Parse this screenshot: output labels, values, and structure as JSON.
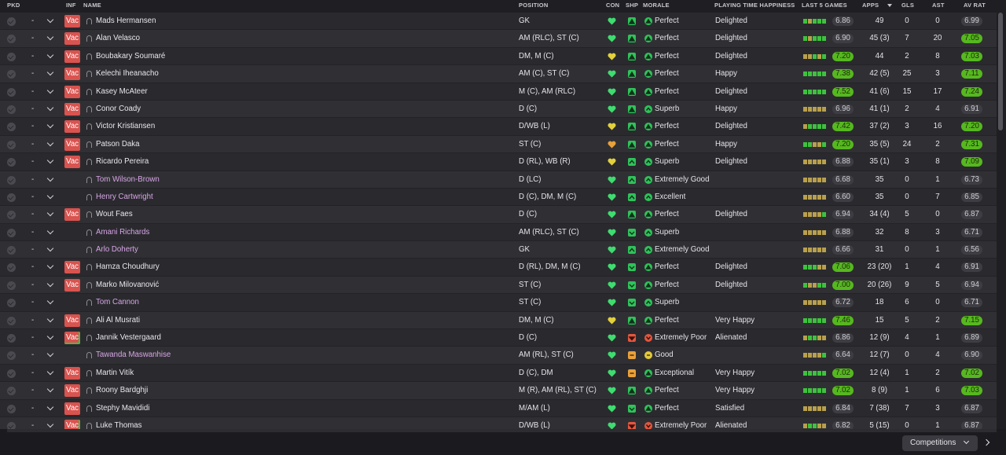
{
  "headers": {
    "pkd": "PKD",
    "inf": "INF",
    "name": "NAME",
    "position": "POSITION",
    "con": "CON",
    "shp": "SHP",
    "morale": "MORALE",
    "playing_time": "PLAYING TIME HAPPINESS",
    "last5": "LAST 5 GAMES",
    "apps": "APPS",
    "gls": "GLS",
    "ast": "AST",
    "avrat": "AV RAT"
  },
  "sorted_column": "apps",
  "sort_direction": "descending",
  "row_dash": "-",
  "inf_badge_label": "Vac",
  "colors": {
    "form_green": "#3ec23e",
    "form_amber": "#b9a04d",
    "highlight_green": "#56b81f",
    "loan_name": "#d7a5e6",
    "vac_badge": "#d9534f"
  },
  "rows": [
    {
      "name": "Mads Hermansen",
      "loan": false,
      "inf": "Vac",
      "position": "GK",
      "con": "green",
      "shp": "peak",
      "morale_level": "perfect",
      "morale": "Perfect",
      "playing_time": "Delighted",
      "form": [
        "g",
        "y",
        "g",
        "g",
        "g"
      ],
      "form_rating": "6.86",
      "form_high": false,
      "apps": "49",
      "gls": "0",
      "ast": "0",
      "avrat": "6.99",
      "avrat_high": false
    },
    {
      "name": "Alan Velasco",
      "loan": false,
      "inf": "Vac",
      "position": "AM (RLC), ST (C)",
      "con": "green",
      "shp": "peak",
      "morale_level": "perfect",
      "morale": "Perfect",
      "playing_time": "Delighted",
      "form": [
        "g",
        "y",
        "g",
        "g",
        "g"
      ],
      "form_rating": "6.90",
      "form_high": false,
      "apps": "45 (3)",
      "gls": "7",
      "ast": "20",
      "avrat": "7.05",
      "avrat_high": true
    },
    {
      "name": "Boubakary Soumaré",
      "loan": false,
      "inf": "Vac",
      "position": "DM, M (C)",
      "con": "yellow",
      "shp": "peak",
      "morale_level": "perfect",
      "morale": "Perfect",
      "playing_time": "Delighted",
      "form": [
        "y",
        "y",
        "g",
        "y",
        "g"
      ],
      "form_rating": "7.20",
      "form_high": true,
      "apps": "44",
      "gls": "2",
      "ast": "8",
      "avrat": "7.03",
      "avrat_high": true
    },
    {
      "name": "Kelechi Iheanacho",
      "loan": false,
      "inf": "Vac",
      "position": "AM (C), ST (C)",
      "con": "green",
      "shp": "peak",
      "morale_level": "perfect",
      "morale": "Perfect",
      "playing_time": "Happy",
      "form": [
        "g",
        "g",
        "g",
        "g",
        "g"
      ],
      "form_rating": "7.38",
      "form_high": true,
      "apps": "42 (5)",
      "gls": "25",
      "ast": "3",
      "avrat": "7.11",
      "avrat_high": true
    },
    {
      "name": "Kasey McAteer",
      "loan": false,
      "inf": "Vac",
      "position": "M (C), AM (RLC)",
      "con": "green",
      "shp": "peak",
      "morale_level": "perfect",
      "morale": "Perfect",
      "playing_time": "Delighted",
      "form": [
        "g",
        "g",
        "g",
        "g",
        "g"
      ],
      "form_rating": "7.52",
      "form_high": true,
      "apps": "41 (6)",
      "gls": "15",
      "ast": "17",
      "avrat": "7.24",
      "avrat_high": true
    },
    {
      "name": "Conor Coady",
      "loan": false,
      "inf": "Vac",
      "position": "D (C)",
      "con": "green",
      "shp": "peak",
      "morale_level": "superb",
      "morale": "Superb",
      "playing_time": "Happy",
      "form": [
        "y",
        "y",
        "y",
        "y",
        "y"
      ],
      "form_rating": "6.96",
      "form_high": false,
      "apps": "41 (1)",
      "gls": "2",
      "ast": "4",
      "avrat": "6.91",
      "avrat_high": false
    },
    {
      "name": "Victor Kristiansen",
      "loan": false,
      "inf": "Vac",
      "position": "D/WB (L)",
      "con": "yellow",
      "shp": "peak",
      "morale_level": "perfect",
      "morale": "Perfect",
      "playing_time": "Delighted",
      "form": [
        "y",
        "g",
        "g",
        "g",
        "g"
      ],
      "form_rating": "7.42",
      "form_high": true,
      "apps": "37 (2)",
      "gls": "3",
      "ast": "16",
      "avrat": "7.20",
      "avrat_high": true
    },
    {
      "name": "Patson Daka",
      "loan": false,
      "inf": "Vac",
      "position": "ST (C)",
      "con": "orange",
      "shp": "peak",
      "morale_level": "perfect",
      "morale": "Perfect",
      "playing_time": "Happy",
      "form": [
        "g",
        "g",
        "y",
        "y",
        "g"
      ],
      "form_rating": "7.20",
      "form_high": true,
      "apps": "35 (5)",
      "gls": "24",
      "ast": "2",
      "avrat": "7.31",
      "avrat_high": true
    },
    {
      "name": "Ricardo Pereira",
      "loan": false,
      "inf": "Vac",
      "position": "D (RL), WB (R)",
      "con": "yellow",
      "shp": "good",
      "morale_level": "superb",
      "morale": "Superb",
      "playing_time": "Delighted",
      "form": [
        "y",
        "y",
        "y",
        "y",
        "y"
      ],
      "form_rating": "6.88",
      "form_high": false,
      "apps": "35 (1)",
      "gls": "3",
      "ast": "8",
      "avrat": "7.09",
      "avrat_high": true
    },
    {
      "name": "Tom Wilson-Brown",
      "loan": true,
      "inf": "",
      "position": "D (LC)",
      "con": "green",
      "shp": "good",
      "morale_level": "good",
      "morale": "Extremely Good",
      "playing_time": "",
      "form": [
        "y",
        "y",
        "y",
        "y",
        "y"
      ],
      "form_rating": "6.68",
      "form_high": false,
      "apps": "35",
      "gls": "0",
      "ast": "1",
      "avrat": "6.73",
      "avrat_high": false
    },
    {
      "name": "Henry Cartwright",
      "loan": true,
      "inf": "",
      "position": "D (C), DM, M (C)",
      "con": "green",
      "shp": "good",
      "morale_level": "good",
      "morale": "Excellent",
      "playing_time": "",
      "form": [
        "y",
        "y",
        "y",
        "y",
        "y"
      ],
      "form_rating": "6.60",
      "form_high": false,
      "apps": "35",
      "gls": "0",
      "ast": "7",
      "avrat": "6.85",
      "avrat_high": false
    },
    {
      "name": "Wout Faes",
      "loan": false,
      "inf": "Vac",
      "position": "D (C)",
      "con": "green",
      "shp": "peak",
      "morale_level": "perfect",
      "morale": "Perfect",
      "playing_time": "Delighted",
      "form": [
        "y",
        "y",
        "y",
        "y",
        "g"
      ],
      "form_rating": "6.94",
      "form_high": false,
      "apps": "34 (4)",
      "gls": "5",
      "ast": "0",
      "avrat": "6.87",
      "avrat_high": false
    },
    {
      "name": "Amani Richards",
      "loan": true,
      "inf": "",
      "position": "AM (RLC), ST (C)",
      "con": "green",
      "shp": "fair",
      "morale_level": "superb",
      "morale": "Superb",
      "playing_time": "",
      "form": [
        "y",
        "y",
        "y",
        "y",
        "y"
      ],
      "form_rating": "6.88",
      "form_high": false,
      "apps": "32",
      "gls": "8",
      "ast": "3",
      "avrat": "6.71",
      "avrat_high": false
    },
    {
      "name": "Arlo Doherty",
      "loan": true,
      "inf": "",
      "position": "GK",
      "con": "green",
      "shp": "good",
      "morale_level": "good",
      "morale": "Extremely Good",
      "playing_time": "",
      "form": [
        "y",
        "y",
        "y",
        "y",
        "y"
      ],
      "form_rating": "6.66",
      "form_high": false,
      "apps": "31",
      "gls": "0",
      "ast": "1",
      "avrat": "6.56",
      "avrat_high": false
    },
    {
      "name": "Hamza Choudhury",
      "loan": false,
      "inf": "Vac",
      "position": "D (RL), DM, M (C)",
      "con": "green",
      "shp": "fair",
      "morale_level": "perfect",
      "morale": "Perfect",
      "playing_time": "Delighted",
      "form": [
        "g",
        "g",
        "g",
        "y",
        "y"
      ],
      "form_rating": "7.06",
      "form_high": true,
      "apps": "23 (20)",
      "gls": "1",
      "ast": "4",
      "avrat": "6.91",
      "avrat_high": false
    },
    {
      "name": "Marko Milovanović",
      "loan": false,
      "inf": "Vac",
      "position": "ST (C)",
      "con": "green",
      "shp": "fair",
      "morale_level": "perfect",
      "morale": "Perfect",
      "playing_time": "Delighted",
      "form": [
        "g",
        "y",
        "y",
        "g",
        "g"
      ],
      "form_rating": "7.00",
      "form_high": true,
      "apps": "20 (26)",
      "gls": "9",
      "ast": "5",
      "avrat": "6.94",
      "avrat_high": false
    },
    {
      "name": "Tom Cannon",
      "loan": true,
      "inf": "",
      "position": "ST (C)",
      "con": "green",
      "shp": "fair",
      "morale_level": "superb",
      "morale": "Superb",
      "playing_time": "",
      "form": [
        "y",
        "y",
        "y",
        "y",
        "y"
      ],
      "form_rating": "6.72",
      "form_high": false,
      "apps": "18",
      "gls": "6",
      "ast": "0",
      "avrat": "6.71",
      "avrat_high": false
    },
    {
      "name": "Ali Al Musrati",
      "loan": false,
      "inf": "Vac",
      "position": "DM, M (C)",
      "con": "yellow",
      "shp": "peak",
      "morale_level": "perfect",
      "morale": "Perfect",
      "playing_time": "Very Happy",
      "form": [
        "g",
        "g",
        "g",
        "g",
        "g"
      ],
      "form_rating": "7.46",
      "form_high": true,
      "apps": "15",
      "gls": "5",
      "ast": "2",
      "avrat": "7.15",
      "avrat_high": true
    },
    {
      "name": "Jannik Vestergaard",
      "loan": false,
      "inf": "Vac",
      "position": "D (C)",
      "con": "green",
      "shp": "poor",
      "morale_level": "poor",
      "morale": "Extremely Poor",
      "playing_time": "Alienated",
      "form": [
        "y",
        "g",
        "g",
        "y",
        "y"
      ],
      "form_rating": "6.86",
      "form_high": false,
      "apps": "12 (9)",
      "gls": "4",
      "ast": "1",
      "avrat": "6.89",
      "avrat_high": false
    },
    {
      "name": "Tawanda Maswanhise",
      "loan": true,
      "inf": "",
      "position": "AM (RL), ST (C)",
      "con": "green",
      "shp": "average",
      "morale_level": "okay",
      "morale": "Good",
      "playing_time": "",
      "form": [
        "y",
        "y",
        "y",
        "y",
        "g"
      ],
      "form_rating": "6.64",
      "form_high": false,
      "apps": "12 (7)",
      "gls": "0",
      "ast": "4",
      "avrat": "6.90",
      "avrat_high": false
    },
    {
      "name": "Martin Vitík",
      "loan": false,
      "inf": "Vac",
      "position": "D (C), DM",
      "con": "green",
      "shp": "average",
      "morale_level": "perfect",
      "morale": "Exceptional",
      "playing_time": "Very Happy",
      "form": [
        "g",
        "g",
        "g",
        "g",
        "g"
      ],
      "form_rating": "7.02",
      "form_high": true,
      "apps": "12 (4)",
      "gls": "1",
      "ast": "2",
      "avrat": "7.02",
      "avrat_high": true
    },
    {
      "name": "Roony Bardghji",
      "loan": false,
      "inf": "Vac",
      "position": "M (R), AM (RL), ST (C)",
      "con": "green",
      "shp": "peak",
      "morale_level": "perfect",
      "morale": "Perfect",
      "playing_time": "Very Happy",
      "form": [
        "g",
        "g",
        "g",
        "g",
        "g"
      ],
      "form_rating": "7.02",
      "form_high": true,
      "apps": "8 (9)",
      "gls": "1",
      "ast": "6",
      "avrat": "7.03",
      "avrat_high": true
    },
    {
      "name": "Stephy Mavididi",
      "loan": false,
      "inf": "Vac",
      "position": "M/AM (L)",
      "con": "green",
      "shp": "fair",
      "morale_level": "perfect",
      "morale": "Perfect",
      "playing_time": "Satisfied",
      "form": [
        "y",
        "y",
        "y",
        "y",
        "y"
      ],
      "form_rating": "6.84",
      "form_high": false,
      "apps": "7 (38)",
      "gls": "7",
      "ast": "3",
      "avrat": "6.87",
      "avrat_high": false
    },
    {
      "name": "Luke Thomas",
      "loan": false,
      "inf": "Vac",
      "position": "D/WB (L)",
      "con": "green",
      "shp": "poor",
      "morale_level": "poor",
      "morale": "Extremely Poor",
      "playing_time": "Alienated",
      "form": [
        "y",
        "g",
        "g",
        "y",
        "y"
      ],
      "form_rating": "6.82",
      "form_high": false,
      "apps": "5 (15)",
      "gls": "0",
      "ast": "1",
      "avrat": "6.87",
      "avrat_high": false
    }
  ],
  "footer": {
    "competitions_label": "Competitions"
  }
}
